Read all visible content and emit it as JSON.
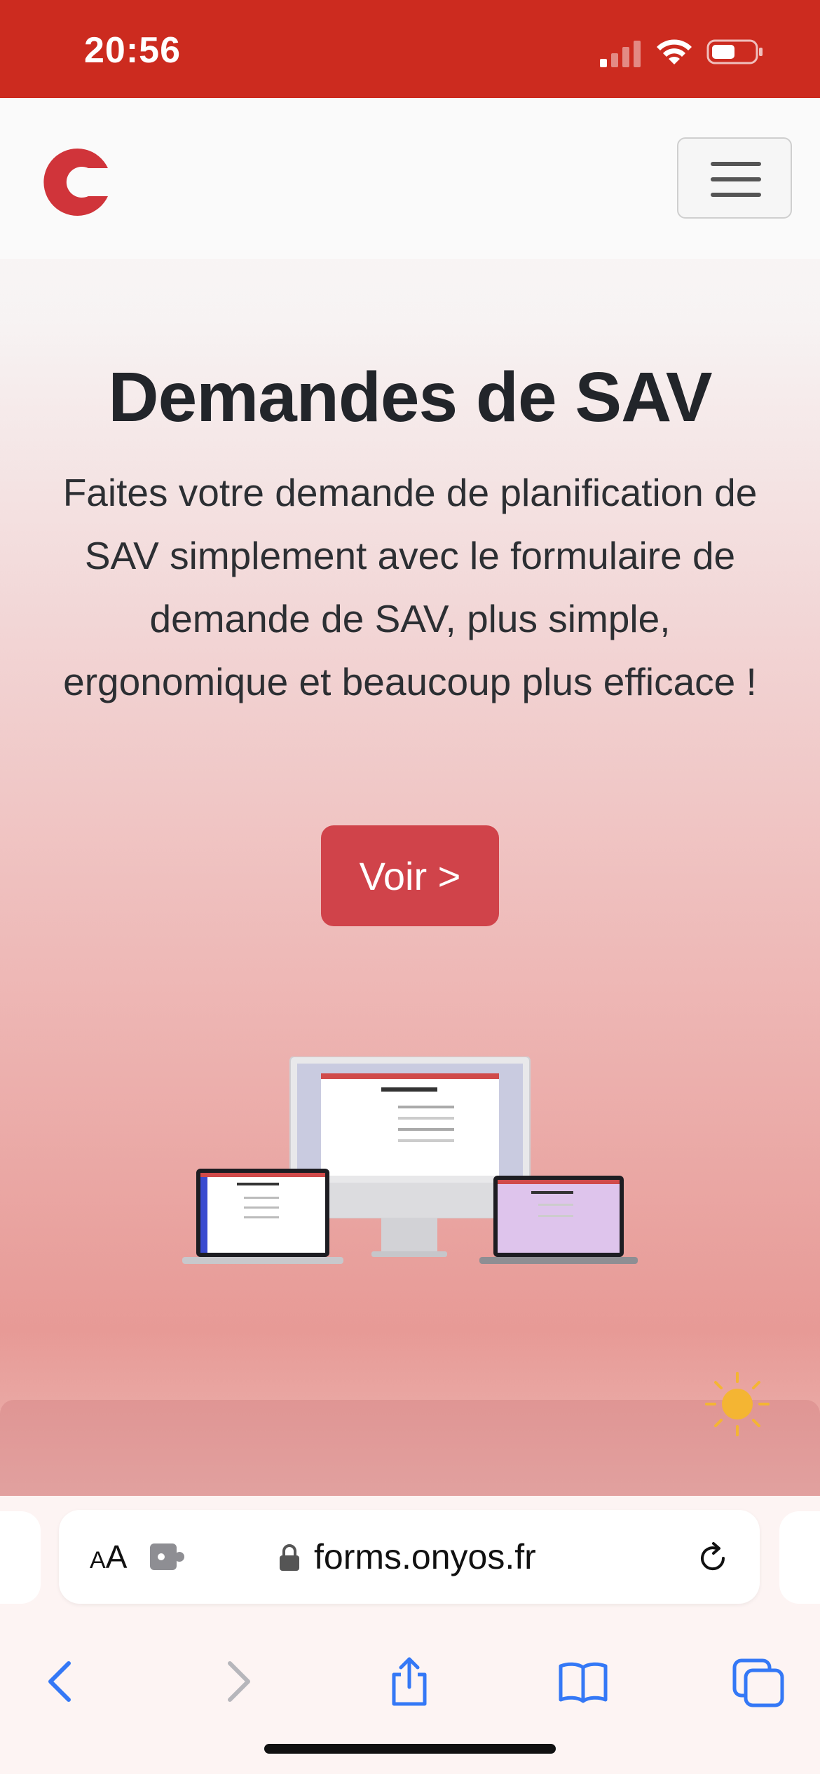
{
  "status_bar": {
    "time": "20:56"
  },
  "navbar": {
    "logo_letter": "C",
    "menu_icon": "hamburger-icon"
  },
  "hero": {
    "title": "Demandes de SAV",
    "description": "Faites votre demande de planification de SAV simplement avec le formulaire de demande de SAV, plus simple, ergonomique et beaucoup plus efficace !",
    "cta_label": "Voir >"
  },
  "browser": {
    "text_size_small": "A",
    "text_size_large": "A",
    "url": "forms.onyos.fr"
  },
  "colors": {
    "status_bar": "#cc2b1f",
    "brand_red": "#d0434a",
    "link_blue": "#3478f6",
    "sun": "#f4b533"
  }
}
